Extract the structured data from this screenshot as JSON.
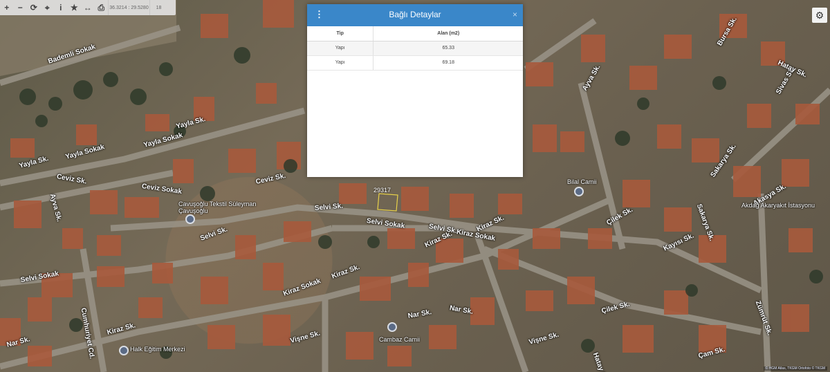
{
  "toolbar": {
    "buttons": [
      {
        "icon": "plus-icon",
        "glyph": "+"
      },
      {
        "icon": "minus-icon",
        "glyph": "−"
      },
      {
        "icon": "refresh-icon",
        "glyph": "⟳"
      },
      {
        "icon": "locate-icon",
        "glyph": "⌖"
      },
      {
        "icon": "info-icon",
        "glyph": "i"
      },
      {
        "icon": "star-icon",
        "glyph": "★"
      },
      {
        "icon": "measure-icon",
        "glyph": "↔"
      },
      {
        "icon": "print-icon",
        "glyph": "⎙"
      }
    ],
    "coordinates": "36.3214 : 29.5280",
    "zoom": "18"
  },
  "settings": {
    "icon": "gear-icon",
    "glyph": "⚙"
  },
  "dialog": {
    "title": "Bağlı Detaylar",
    "columns": [
      "Tip",
      "Alan (m2)"
    ],
    "rows": [
      [
        "Yapı",
        "65.33"
      ],
      [
        "Yapı",
        "69.18"
      ]
    ],
    "header_color": "#3a87c9"
  },
  "map": {
    "streets": [
      "Bademli Sokak",
      "Yayla Sokak",
      "Yayla Sk.",
      "Yayla Sokak",
      "Yayla Sk.",
      "Ceviz Sk.",
      "Ceviz Sokak",
      "Ceviz Sk.",
      "Selvi Sk.",
      "Selvi Sk.",
      "Selvi Sokak",
      "Selvi Sk.",
      "Selvi Sokak",
      "Kiraz Sk.",
      "Kiraz Sokak",
      "Kiraz Sk.",
      "Kiraz Sk.",
      "Kiraz Sokak",
      "Kiraz Sk.",
      "Nar Sk.",
      "Nar Sk.",
      "Nar Sk.",
      "Vişne Sk.",
      "Vişne Sk.",
      "Çilek Sk.",
      "Çilek Sk.",
      "Kayısı Sk.",
      "Sakarya Sk.",
      "Sakarya Sk.",
      "Sivas Sk.",
      "Bursa Sk.",
      "Hatay Sk.",
      "Ayva Sk.",
      "Ayva Sk.",
      "Cumhuriyet Cd.",
      "Akasya Sk.",
      "Zümrüt Sk.",
      "Çam Sk.",
      "Hatay Sk."
    ],
    "pois": [
      "Cavuşoğlu Tekstil Süleyman Çavuşoğlu",
      "Bilal Camii",
      "Cambaz Camii",
      "Halk Eğitim Merkezi",
      "Akdağ Akaryakıt İstasyonu"
    ],
    "parcel_number": "29317"
  },
  "attribution": "© HGM Atlas, TKGM Ortofoto © TKGM"
}
